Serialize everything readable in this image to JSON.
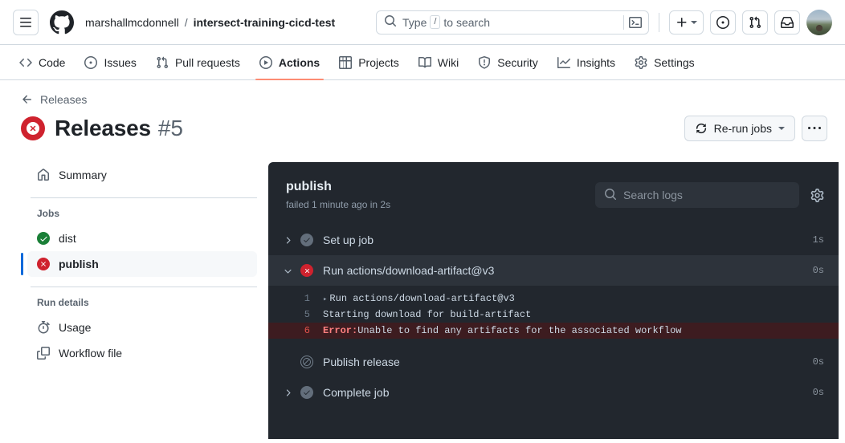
{
  "header": {
    "owner": "marshallmcdonnell",
    "separator": "/",
    "repo": "intersect-training-cicd-test",
    "search_placeholder_before": "Type",
    "search_kbd": "/",
    "search_placeholder_after": "to search"
  },
  "repo_nav": [
    {
      "label": "Code",
      "icon": "code-icon",
      "active": false
    },
    {
      "label": "Issues",
      "icon": "issue-opened-icon",
      "active": false
    },
    {
      "label": "Pull requests",
      "icon": "git-pull-request-icon",
      "active": false
    },
    {
      "label": "Actions",
      "icon": "play-icon",
      "active": true
    },
    {
      "label": "Projects",
      "icon": "table-icon",
      "active": false
    },
    {
      "label": "Wiki",
      "icon": "book-icon",
      "active": false
    },
    {
      "label": "Security",
      "icon": "shield-icon",
      "active": false
    },
    {
      "label": "Insights",
      "icon": "graph-icon",
      "active": false
    },
    {
      "label": "Settings",
      "icon": "gear-icon",
      "active": false
    }
  ],
  "run": {
    "back_label": "Releases",
    "title": "Releases",
    "number": "#5",
    "status": "failure",
    "rerun_label": "Re-run jobs"
  },
  "sidebar": {
    "summary_label": "Summary",
    "jobs_heading": "Jobs",
    "jobs": [
      {
        "label": "dist",
        "status": "success",
        "selected": false
      },
      {
        "label": "publish",
        "status": "failure",
        "selected": true
      }
    ],
    "run_details_heading": "Run details",
    "details": [
      {
        "label": "Usage",
        "icon": "stopwatch-icon"
      },
      {
        "label": "Workflow file",
        "icon": "file-icon"
      }
    ]
  },
  "logs": {
    "job_name": "publish",
    "job_status_text": "failed 1 minute ago in 2s",
    "search_placeholder": "Search logs",
    "steps": [
      {
        "label": "Set up job",
        "status": "neutral",
        "duration": "1s",
        "expanded": false,
        "has_chevron": true
      },
      {
        "label": "Run actions/download-artifact@v3",
        "status": "failure",
        "duration": "0s",
        "expanded": true,
        "has_chevron": true,
        "lines": [
          {
            "no": "1",
            "text": "Run actions/download-artifact@v3",
            "error": false,
            "collapsible": true
          },
          {
            "no": "5",
            "text": "Starting download for build-artifact",
            "error": false,
            "collapsible": false
          },
          {
            "no": "6",
            "text": "Unable to find any artifacts for the associated workflow",
            "error": true,
            "error_label": "Error:",
            "collapsible": false
          }
        ]
      },
      {
        "label": "Publish release",
        "status": "skipped",
        "duration": "0s",
        "expanded": false,
        "has_chevron": false
      },
      {
        "label": "Complete job",
        "status": "neutral",
        "duration": "0s",
        "expanded": false,
        "has_chevron": true
      }
    ]
  },
  "colors": {
    "failure": "#cf222e",
    "success": "#1a7f37",
    "accent": "#0969da",
    "active_tab_underline": "#fd8c73",
    "panel_bg": "#22272e",
    "error_line_bg": "#3d1c20"
  }
}
